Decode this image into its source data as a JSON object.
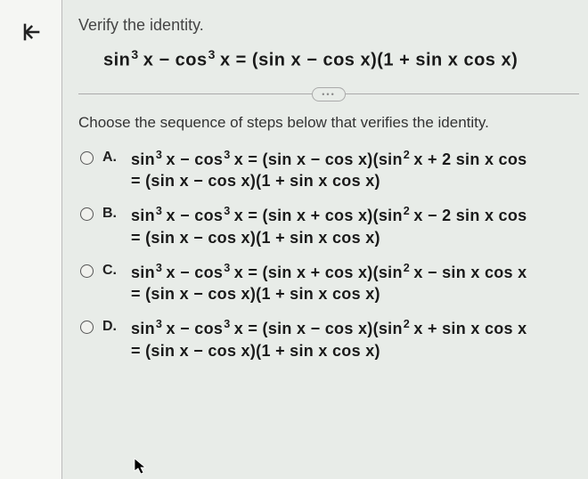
{
  "prompt": "Verify the identity.",
  "main_equation": "sin³ x − cos³ x = (sin x − cos x)(1 + sin x cos x)",
  "divider_badge": "•••",
  "subprompt": "Choose the sequence of steps below that verifies the identity.",
  "options": [
    {
      "label": "A.",
      "line1": "sin³ x − cos³ x = (sin x − cos x)(sin² x + 2 sin x cos",
      "line2": "= (sin x − cos x)(1 + sin x cos x)"
    },
    {
      "label": "B.",
      "line1": "sin³ x − cos³ x = (sin x + cos x)(sin² x − 2 sin x cos",
      "line2": "= (sin x − cos x)(1 + sin x cos x)"
    },
    {
      "label": "C.",
      "line1": "sin³ x − cos³ x = (sin x + cos x)(sin² x − sin x cos x",
      "line2": "= (sin x − cos x)(1 + sin x cos x)"
    },
    {
      "label": "D.",
      "line1": "sin³ x − cos³ x = (sin x − cos x)(sin² x + sin x cos x",
      "line2": "= (sin x − cos x)(1 + sin x cos x)"
    }
  ]
}
